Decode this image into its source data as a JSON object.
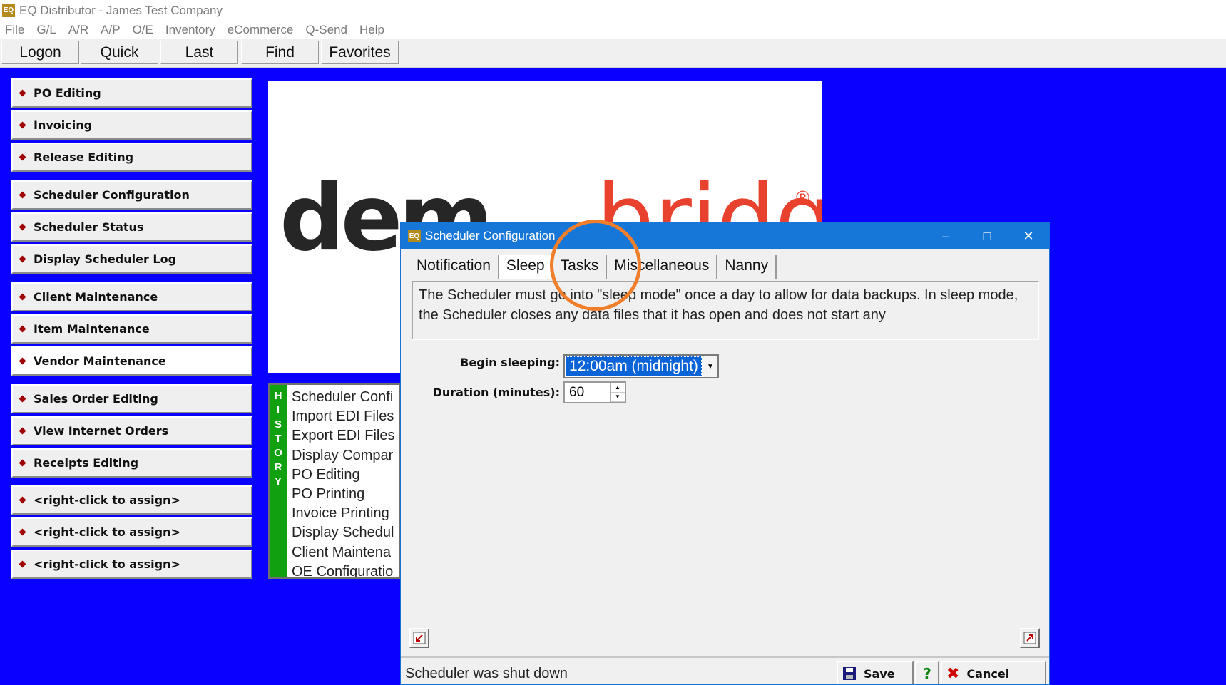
{
  "app": {
    "title": "EQ Distributor - James Test Company",
    "icon_text": "EQ"
  },
  "menu": [
    "File",
    "G/L",
    "A/R",
    "A/P",
    "O/E",
    "Inventory",
    "eCommerce",
    "Q-Send",
    "Help"
  ],
  "toolbar": [
    "Logon",
    "Quick",
    "Last",
    "Find",
    "Favorites"
  ],
  "nav": [
    "PO Editing",
    "Invoicing",
    "Release Editing",
    "Scheduler Configuration",
    "Scheduler Status",
    "Display Scheduler Log",
    "Client Maintenance",
    "Item Maintenance",
    "Vendor Maintenance",
    "Sales Order Editing",
    "View Internet Orders",
    "Receipts Editing",
    "<right-click to assign>",
    "<right-click to assign>",
    "<right-click to assign>"
  ],
  "logo": {
    "part1": "dem",
    "part2": "bridge",
    "reg": "®"
  },
  "history": {
    "letters": [
      "H",
      "I",
      "S",
      "T",
      "O",
      "R",
      "Y"
    ],
    "items": [
      "Scheduler Confi",
      "Import EDI Files",
      "Export EDI Files",
      "Display Compar",
      "PO Editing",
      "PO Printing",
      "Invoice Printing",
      "Display Schedul",
      "Client Maintena",
      "OE Configuratio"
    ]
  },
  "dialog": {
    "title": "Scheduler Configuration",
    "tabs": [
      "Notification",
      "Sleep",
      "Tasks",
      "Miscellaneous",
      "Nanny"
    ],
    "description": "The Scheduler must go into \"sleep mode\" once a day to allow for data backups.  In sleep mode, the Scheduler closes any data files that it has open and does not start any",
    "begin_label": "Begin sleeping:",
    "begin_value": "12:00am (midnight)",
    "duration_label": "Duration (minutes):",
    "duration_value": "60",
    "status": "Scheduler was shut down",
    "save_label": "Save",
    "help_label": "?",
    "cancel_label": "Cancel"
  },
  "colors": {
    "background": "#0a00ff",
    "history_bar": "#10a010",
    "logo_red": "#e8412d",
    "highlight": "#f07e2a"
  }
}
